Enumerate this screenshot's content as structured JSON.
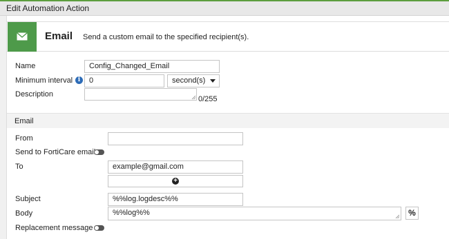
{
  "window": {
    "title": "Edit Automation Action"
  },
  "header": {
    "title": "Email",
    "description": "Send a custom email to the specified recipient(s).",
    "icon": "envelope-icon",
    "accent": "#4e9a4a"
  },
  "form": {
    "name": {
      "label": "Name",
      "value": "Config_Changed_Email"
    },
    "min_interval": {
      "label": "Minimum interval",
      "value": "0",
      "unit": "second(s)",
      "info_icon": "info-icon"
    },
    "description": {
      "label": "Description",
      "value": "",
      "counter": "0/255"
    }
  },
  "email_section": {
    "title": "Email",
    "from": {
      "label": "From",
      "value": ""
    },
    "forticare": {
      "label": "Send to FortiCare email",
      "enabled": false
    },
    "to": {
      "label": "To",
      "recipients": [
        "example@gmail.com"
      ],
      "add_icon": "plus-icon"
    },
    "subject": {
      "label": "Subject",
      "value": "%%log.logdesc%%"
    },
    "body": {
      "label": "Body",
      "value": "%%log%%",
      "variable_button": "%"
    },
    "replacement": {
      "label": "Replacement message",
      "enabled": false
    }
  }
}
